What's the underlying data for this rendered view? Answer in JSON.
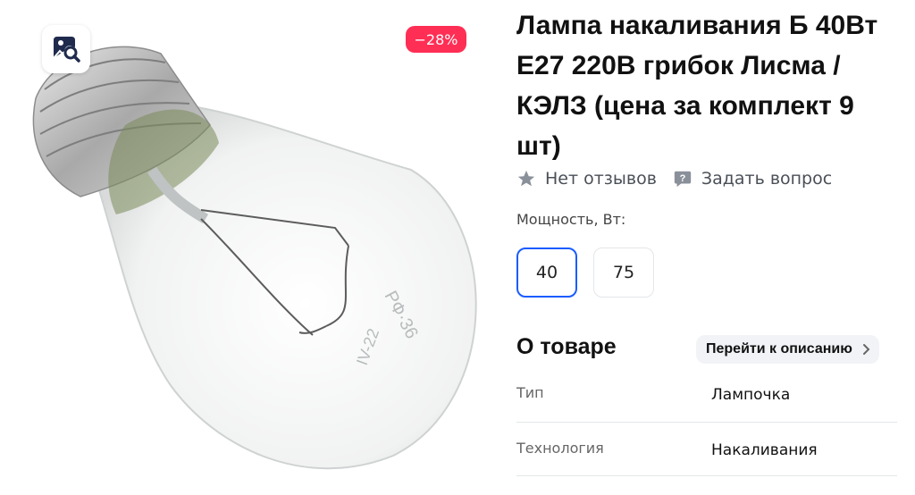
{
  "product": {
    "title": "Лампа накаливания Б 40Вт Е27 220В грибок Лисма / КЭЛЗ (цена за комплект 9 шт)",
    "discount_badge": "−28%",
    "bulb_marking_1": "РФ·36",
    "bulb_marking_2": "IV-22"
  },
  "meta": {
    "reviews_label": "Нет отзывов",
    "question_label": "Задать вопрос"
  },
  "power": {
    "label": "Мощность, Вт:",
    "options": [
      "40",
      "75"
    ],
    "selected": "40"
  },
  "about": {
    "title": "О товаре",
    "goto_label": "Перейти к описанию",
    "specs": [
      {
        "key": "Тип",
        "value": "Лампочка"
      },
      {
        "key": "Технология",
        "value": "Накаливания"
      }
    ]
  },
  "colors": {
    "accent": "#1a5cff",
    "discount": "#ff2e55"
  },
  "icons": [
    "image-search-icon",
    "star-icon",
    "question-bubble-icon",
    "chevron-right-icon"
  ]
}
